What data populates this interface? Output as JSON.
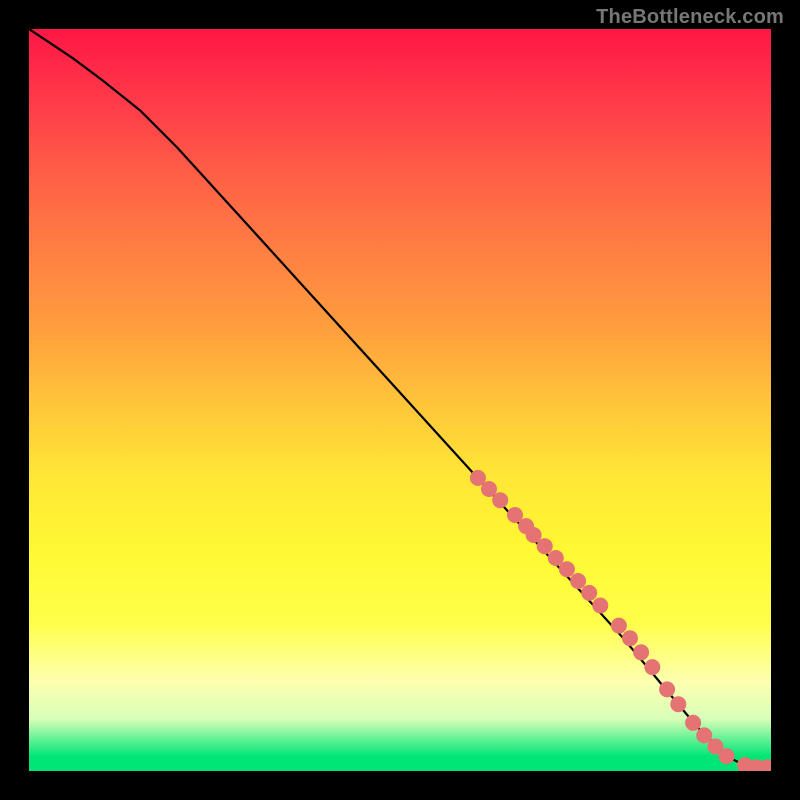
{
  "attribution": "TheBottleneck.com",
  "chart_data": {
    "type": "line",
    "title": "",
    "xlabel": "",
    "ylabel": "",
    "xlim": [
      0,
      100
    ],
    "ylim": [
      0,
      100
    ],
    "curve": {
      "x": [
        0,
        3,
        6,
        10,
        15,
        20,
        30,
        40,
        50,
        60,
        70,
        80,
        85,
        90,
        92,
        94,
        96,
        98,
        100
      ],
      "y": [
        100,
        98,
        96,
        93,
        89,
        84,
        73,
        62,
        51,
        40,
        29,
        18,
        12,
        6,
        4,
        2,
        1,
        0.5,
        0.5
      ]
    },
    "markers": [
      {
        "x": 60.5,
        "y": 39.5
      },
      {
        "x": 62.0,
        "y": 38.0
      },
      {
        "x": 63.5,
        "y": 36.5
      },
      {
        "x": 65.5,
        "y": 34.5
      },
      {
        "x": 67.0,
        "y": 33.0
      },
      {
        "x": 68.0,
        "y": 31.8
      },
      {
        "x": 69.5,
        "y": 30.3
      },
      {
        "x": 71.0,
        "y": 28.7
      },
      {
        "x": 72.5,
        "y": 27.2
      },
      {
        "x": 74.0,
        "y": 25.6
      },
      {
        "x": 75.5,
        "y": 24.0
      },
      {
        "x": 77.0,
        "y": 22.3
      },
      {
        "x": 79.5,
        "y": 19.6
      },
      {
        "x": 81.0,
        "y": 17.9
      },
      {
        "x": 82.5,
        "y": 16.0
      },
      {
        "x": 84.0,
        "y": 14.0
      },
      {
        "x": 86.0,
        "y": 11.0
      },
      {
        "x": 87.5,
        "y": 9.0
      },
      {
        "x": 89.5,
        "y": 6.5
      },
      {
        "x": 91.0,
        "y": 4.8
      },
      {
        "x": 92.5,
        "y": 3.3
      },
      {
        "x": 94.0,
        "y": 2.0
      },
      {
        "x": 96.5,
        "y": 0.8
      },
      {
        "x": 98.0,
        "y": 0.5
      },
      {
        "x": 99.5,
        "y": 0.5
      }
    ],
    "marker_color": "#e57373",
    "line_color": "#000000"
  }
}
